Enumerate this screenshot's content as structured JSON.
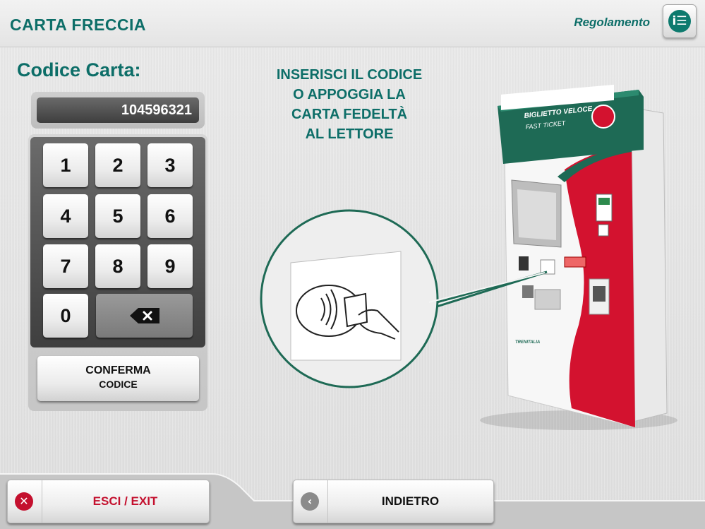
{
  "header": {
    "title": "CARTA FRECCIA",
    "regolamento": "Regolamento",
    "info_icon": "info-list-icon"
  },
  "codice_label": "Codice Carta:",
  "display_value": "104596321",
  "instructions": [
    "INSERISCI IL CODICE",
    "O APPOGGIA LA",
    "CARTA FEDELTÀ",
    "AL LETTORE"
  ],
  "keypad": {
    "keys": [
      "1",
      "2",
      "3",
      "4",
      "5",
      "6",
      "7",
      "8",
      "9",
      "0"
    ],
    "delete_icon": "backspace-icon"
  },
  "confirm": {
    "line1": "CONFERMA",
    "line2": "CODICE"
  },
  "kiosk": {
    "brand_line1": "BIGLIETTO VELOCE",
    "brand_line2": "FAST TICKET",
    "logo_text": "TRENITALIA"
  },
  "footer": {
    "exit_label": "ESCI / EXIT",
    "back_label": "INDIETRO",
    "exit_icon": "close-icon",
    "back_icon": "chevron-left-icon"
  },
  "colors": {
    "accent": "#0d6e68",
    "exit_red": "#c4102e",
    "back_grey": "#8a8a8a",
    "kiosk_red": "#d3122f",
    "kiosk_green": "#1e6a55"
  }
}
